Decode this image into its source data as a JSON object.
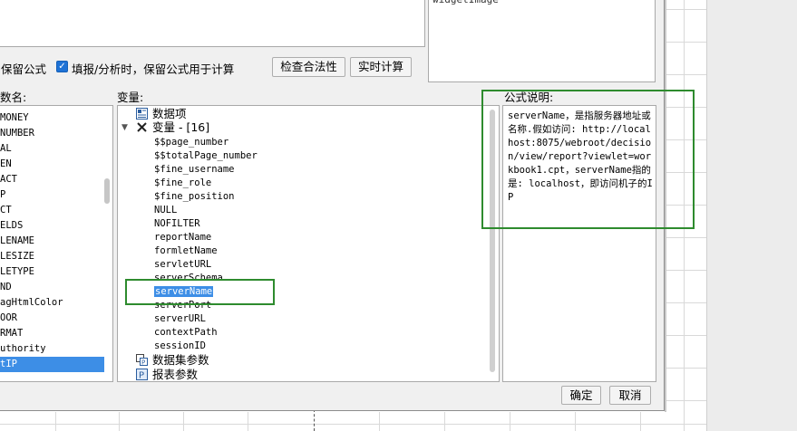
{
  "dialog": {
    "widget_box_text": "widgetImage",
    "keep_formula_label": "保留公式",
    "fill_checkbox": {
      "checked": true,
      "label": "填报/分析时，保留公式用于计算"
    },
    "buttons": {
      "check_validity": "检查合法性",
      "realtime_calc": "实时计算",
      "ok": "确定",
      "cancel": "取消"
    },
    "labels": {
      "function_name": "数名:",
      "variable": "变量:",
      "formula_desc": "公式说明:"
    }
  },
  "function_list": {
    "items": [
      "MONEY",
      "NUMBER",
      "AL",
      "EN",
      "ACT",
      "P",
      "CT",
      "ELDS",
      "LENAME",
      "LESIZE",
      "LETYPE",
      "ND",
      "agHtmlColor",
      "OOR",
      "RMAT",
      "uthority",
      "tIP"
    ],
    "selected_index": 16
  },
  "variable_tree": {
    "data_item": "数据项",
    "variable_group": "变量 - [16]",
    "variables": [
      "$$page_number",
      "$$totalPage_number",
      "$fine_username",
      "$fine_role",
      "$fine_position",
      "NULL",
      "NOFILTER",
      "reportName",
      "formletName",
      "servletURL",
      "serverSchema",
      "serverName",
      "serverPort",
      "serverURL",
      "contextPath",
      "sessionID"
    ],
    "selected_variable": "serverName",
    "dataset_params": "数据集参数",
    "report_params": "报表参数"
  },
  "formula_description": {
    "text": "serverName，是指服务器地址或名称.假如访问: http://localhost:8075/webroot/decision/view/report?viewlet=workbook1.cpt，serverName指的是: localhost，即访问机子的IP"
  },
  "colors": {
    "annotation_green": "#2e8b2e",
    "selection_blue": "#3d8ee6",
    "checkbox_blue": "#1e72d6"
  }
}
